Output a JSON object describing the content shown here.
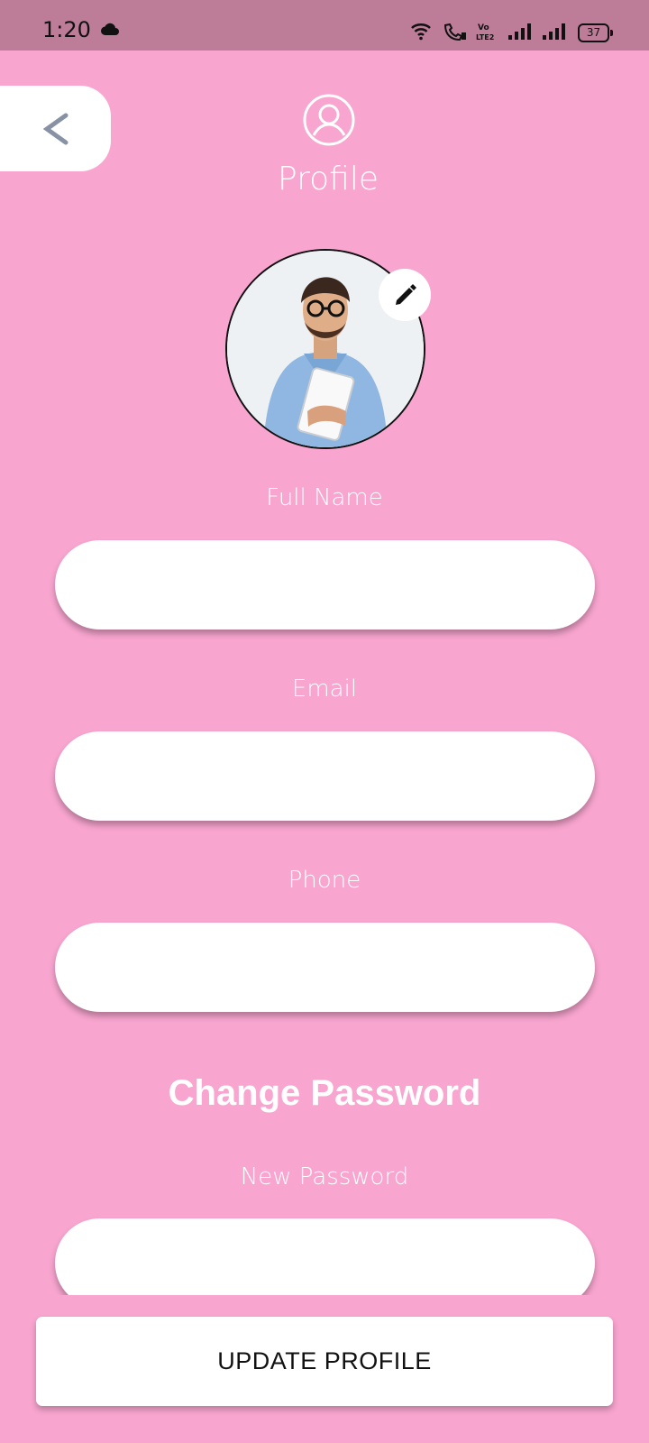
{
  "status_bar": {
    "time": "1:20",
    "battery": "37",
    "icons": [
      "cloud-icon",
      "wifi-icon",
      "call-icon",
      "volte-icon",
      "signal-icon",
      "signal-icon"
    ]
  },
  "header": {
    "back_icon": "<",
    "title": "Profile"
  },
  "fields": {
    "full_name_label": "Full Name",
    "email_label": "Email",
    "phone_label": "Phone",
    "full_name_value": "",
    "email_value": "",
    "phone_value": ""
  },
  "password": {
    "section_title": "Change Password",
    "new_password_label": "New Password",
    "new_password_value": ""
  },
  "actions": {
    "update_label": "UPDATE PROFILE"
  },
  "colors": {
    "background": "#f8a5cf",
    "status_bar": "#bd7c98",
    "field": "#ffffff",
    "back_arrow": "#8793a5"
  }
}
